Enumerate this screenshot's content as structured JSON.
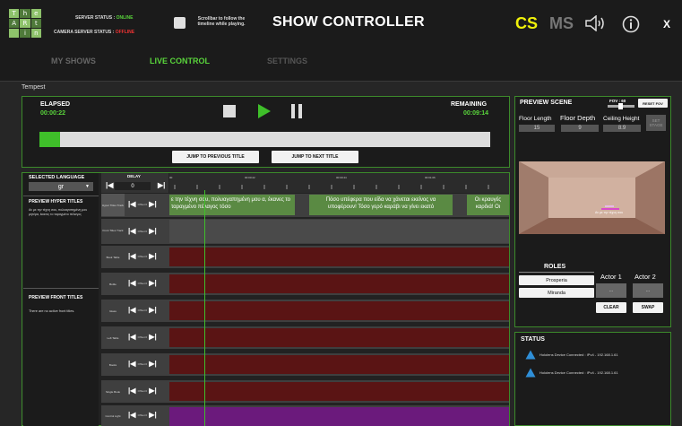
{
  "colors": {
    "accent_green": "#3c8a2b",
    "online": "#59d43b",
    "offline": "#e33333",
    "cs_yellow": "#f0f10a"
  },
  "header": {
    "logo_letters": [
      "T",
      "h",
      "e",
      "A",
      "R",
      "t",
      "",
      "i",
      "n"
    ],
    "server_status_label": "SERVER STATUS :",
    "server_status_value": "ONLINE",
    "camera_status_label": "CAMERA SERVER STATUS :",
    "camera_status_value": "OFFLINE",
    "scroll_checkbox_label": "Scrollbar to follow the timeline while playing.",
    "title": "SHOW CONTROLLER",
    "cs_label": "CS",
    "ms_label": "MS",
    "close_label": "X"
  },
  "nav": {
    "tabs": [
      "MY SHOWS",
      "LIVE CONTROL",
      "SETTINGS"
    ],
    "active": "LIVE CONTROL"
  },
  "show_name": "Tempest",
  "playback": {
    "elapsed_label": "ELAPSED",
    "elapsed_value": "00:00:22",
    "remaining_label": "REMAINING",
    "remaining_value": "00:09:14",
    "progress": 0.046,
    "jump_prev": "JUMP TO PREVIOUS TITLE",
    "jump_next": "JUMP TO NEXT TITLE"
  },
  "language": {
    "label": "SELECTED LANGUAGE",
    "value": "gr",
    "delay_label": "DELAY",
    "delay_value": "0"
  },
  "preview_hyper": {
    "title": "PREVIEW HYPER TITLES",
    "text": "Αν με την τέχνη σου, πολυαγαπημένη μου μητέρα, έκανες το ταραγμένο πέλαγος"
  },
  "preview_front": {
    "title": "PREVIEW FRONT TITLES",
    "text": "There are no active front titles."
  },
  "timeline": {
    "ticks": [
      "00",
      "00:00:22",
      "00:00:44",
      "00:01:06"
    ],
    "hyper_captions": [
      "ε την τέχνη σου, πολυαγαπημένη μου α, έκανες το ταραγμένο πέλαγος τόσο",
      "Πόσο υπέφερα που είδα να χάνεται εκείνος να υποφέρουν! Τόσο γερό καράβι να γίνει εκατό",
      "Οι κραυγές καρδιά! Οι"
    ],
    "offset_label": "Offset 0",
    "rows": [
      "Hyper Titles Track",
      "Front Titles Track",
      "Book Table",
      "Bottle",
      "Glass",
      "Left Table",
      "Books",
      "Single Book",
      "Control Light"
    ]
  },
  "preview_scene": {
    "title": "PREVIEW SCENE",
    "fov_label": "FOV : 60",
    "reset_fov": "RESET FOV",
    "floor_length_label": "Floor Length",
    "floor_length_value": "15",
    "floor_depth_label": "Floor Depth",
    "floor_depth_value": "9",
    "ceiling_height_label": "Ceiling Height",
    "ceiling_height_value": "8.9",
    "set_stage": "SET STAGE",
    "scene_caption": "Αν με την τέχνη σου"
  },
  "roles": {
    "title": "ROLES",
    "items": [
      "Prosperia",
      "Miranda"
    ],
    "actor1_label": "Actor 1",
    "actor2_label": "Actor 2",
    "actor_value": "...",
    "clear": "CLEAR",
    "swap": "SWAP"
  },
  "status": {
    "title": "STATUS",
    "entries": [
      "Hololens Device Connected : IPv4 - 192.168.1.61",
      "Hololens Device Connected : IPv4 - 192.168.1.61"
    ]
  }
}
